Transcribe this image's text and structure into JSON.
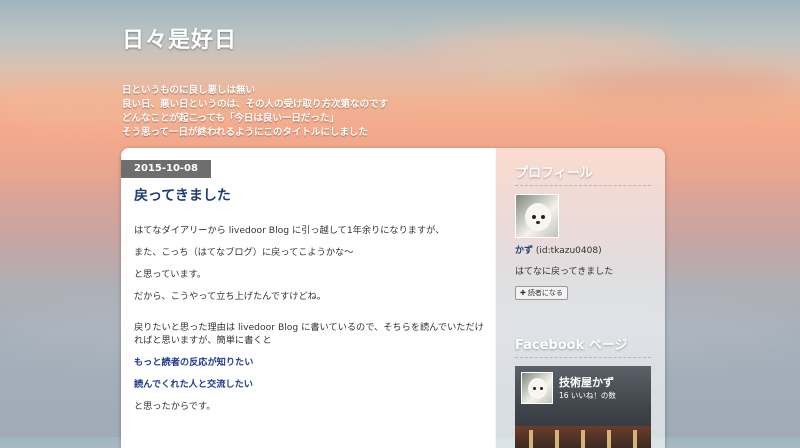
{
  "blog": {
    "title": "日々是好日",
    "description": [
      "日というものに良し悪しは無い",
      "良い日、悪い日というのは、その人の受け取り方次第なのです",
      "どんなことが起こっても「今日は良い一日だった」",
      "そう思って一日が終われるようにこのタイトルにしました"
    ]
  },
  "post": {
    "date": "2015-10-08",
    "title": "戻ってきました",
    "paragraphs": [
      "はてなダイアリーから livedoor Blog に引っ越して1年余りになりますが、",
      "また、こっち（はてなブログ）に戻ってこようかな〜",
      "と思っています。",
      "だから、こうやって立ち上げたんですけどね。",
      "戻りたいと思った理由は livedoor Blog に書いているので、そちらを読んでいただければと思いますが、簡単に書くと",
      "もっと読者の反応が知りたい",
      "読んでくれた人と交流したい",
      "と思ったからです。"
    ]
  },
  "sidebar": {
    "profile": {
      "title": "プロフィール",
      "name": "かず",
      "id": "(id:tkazu0408)",
      "text": "はてなに戻ってきました",
      "reader_button": "読者になる",
      "reader_icon": "plus-icon"
    },
    "facebook": {
      "title": "Facebook ページ",
      "page_name": "技術屋かず",
      "likes": "16 いいね！の数"
    }
  },
  "colors": {
    "link": "#1f3f73",
    "date_badge": "#6e6e6e"
  }
}
